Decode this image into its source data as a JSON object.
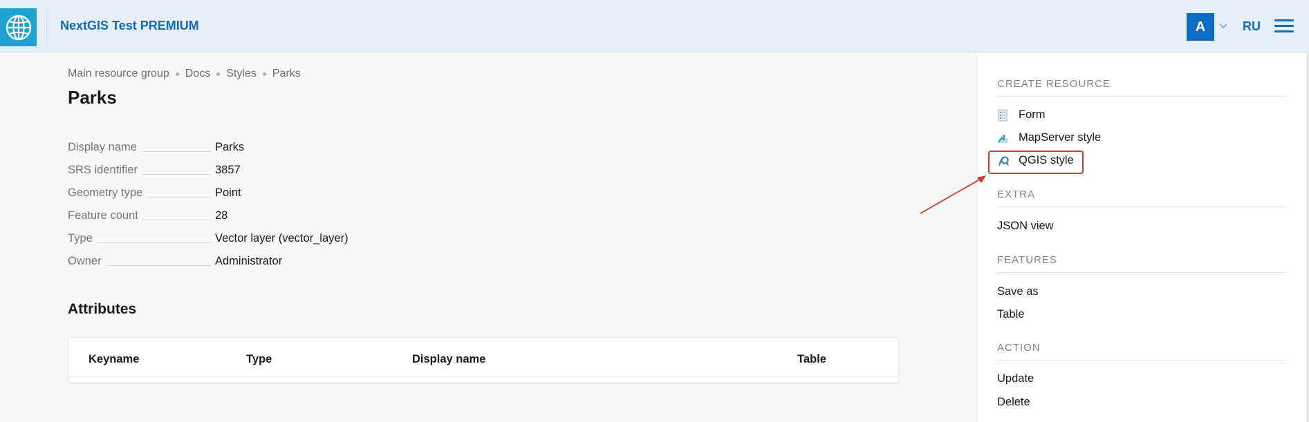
{
  "header": {
    "app_title": "NextGIS Test PREMIUM",
    "avatar_letter": "A",
    "lang": "RU",
    "icons": [
      "globe-logo-icon",
      "chevron-down-icon",
      "hamburger-menu-icon"
    ]
  },
  "breadcrumb": [
    "Main resource group",
    "Docs",
    "Styles",
    "Parks"
  ],
  "page_title": "Parks",
  "properties": [
    {
      "key": "Display name",
      "value": "Parks"
    },
    {
      "key": "SRS identifier",
      "value": "3857"
    },
    {
      "key": "Geometry type",
      "value": "Point"
    },
    {
      "key": "Feature count",
      "value": "28"
    },
    {
      "key": "Type",
      "value": "Vector layer (vector_layer)"
    },
    {
      "key": "Owner",
      "value": "Administrator"
    }
  ],
  "attributes": {
    "title": "Attributes",
    "columns": [
      "Keyname",
      "Type",
      "Display name",
      "Table"
    ]
  },
  "sidebar": {
    "create_heading": "CREATE RESOURCE",
    "create_items": [
      "Form",
      "MapServer style",
      "QGIS style"
    ],
    "extra_heading": "EXTRA",
    "extra_items": [
      "JSON view"
    ],
    "features_heading": "FEATURES",
    "features_items": [
      "Save as",
      "Table"
    ],
    "action_heading": "ACTION",
    "action_items": [
      "Update",
      "Delete"
    ]
  },
  "colors": {
    "brand_blue": "#0d6dbf",
    "logo_bg": "#1aa3d4",
    "annotation_red": "#e0312b"
  }
}
